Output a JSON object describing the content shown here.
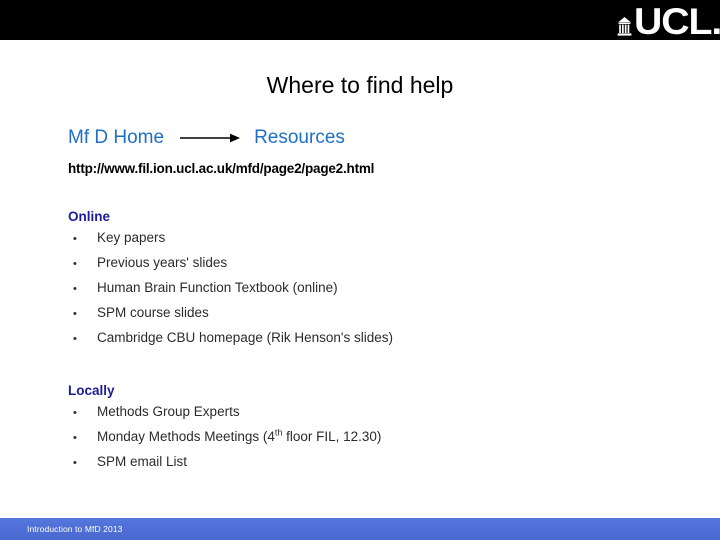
{
  "header": {
    "background_color": "#000000",
    "logo": {
      "icon": "ucl-portico-icon",
      "wordmark": "UCL."
    }
  },
  "slide": {
    "title": "Where to find help",
    "title_color": "#000000",
    "background_color": "#ffffff"
  },
  "breadcrumb": {
    "color": "#1f6fc4",
    "start": "Mf D Home",
    "arrow_icon": "right-arrow-icon",
    "end": "Resources"
  },
  "url": {
    "text": "http://www.fil.ion.ucl.ac.uk/mfd/page2/page2.html",
    "color": "#000000"
  },
  "sections": [
    {
      "heading": "Online",
      "heading_color": "#1c1c96",
      "bullet_glyph": "•",
      "items": [
        "Key papers",
        "Previous years' slides",
        "Human Brain Function Textbook (online)",
        "SPM course slides",
        "Cambridge CBU homepage (Rik Henson's slides)"
      ]
    },
    {
      "heading": "Locally",
      "heading_color": "#1c1c96",
      "bullet_glyph": "•",
      "items": [
        "Methods Group Experts",
        "Monday Methods Meetings (4th floor FIL, 12.30)",
        "SPM email List"
      ],
      "item_1_parts": {
        "before": "Monday Methods Meetings (4",
        "superscript": "th",
        "after": " floor FIL, 12.30)"
      }
    }
  ],
  "footer": {
    "text": "Introduction to MfD 2013",
    "text_color": "#ffffff",
    "background_color": "#4f6fd6"
  }
}
